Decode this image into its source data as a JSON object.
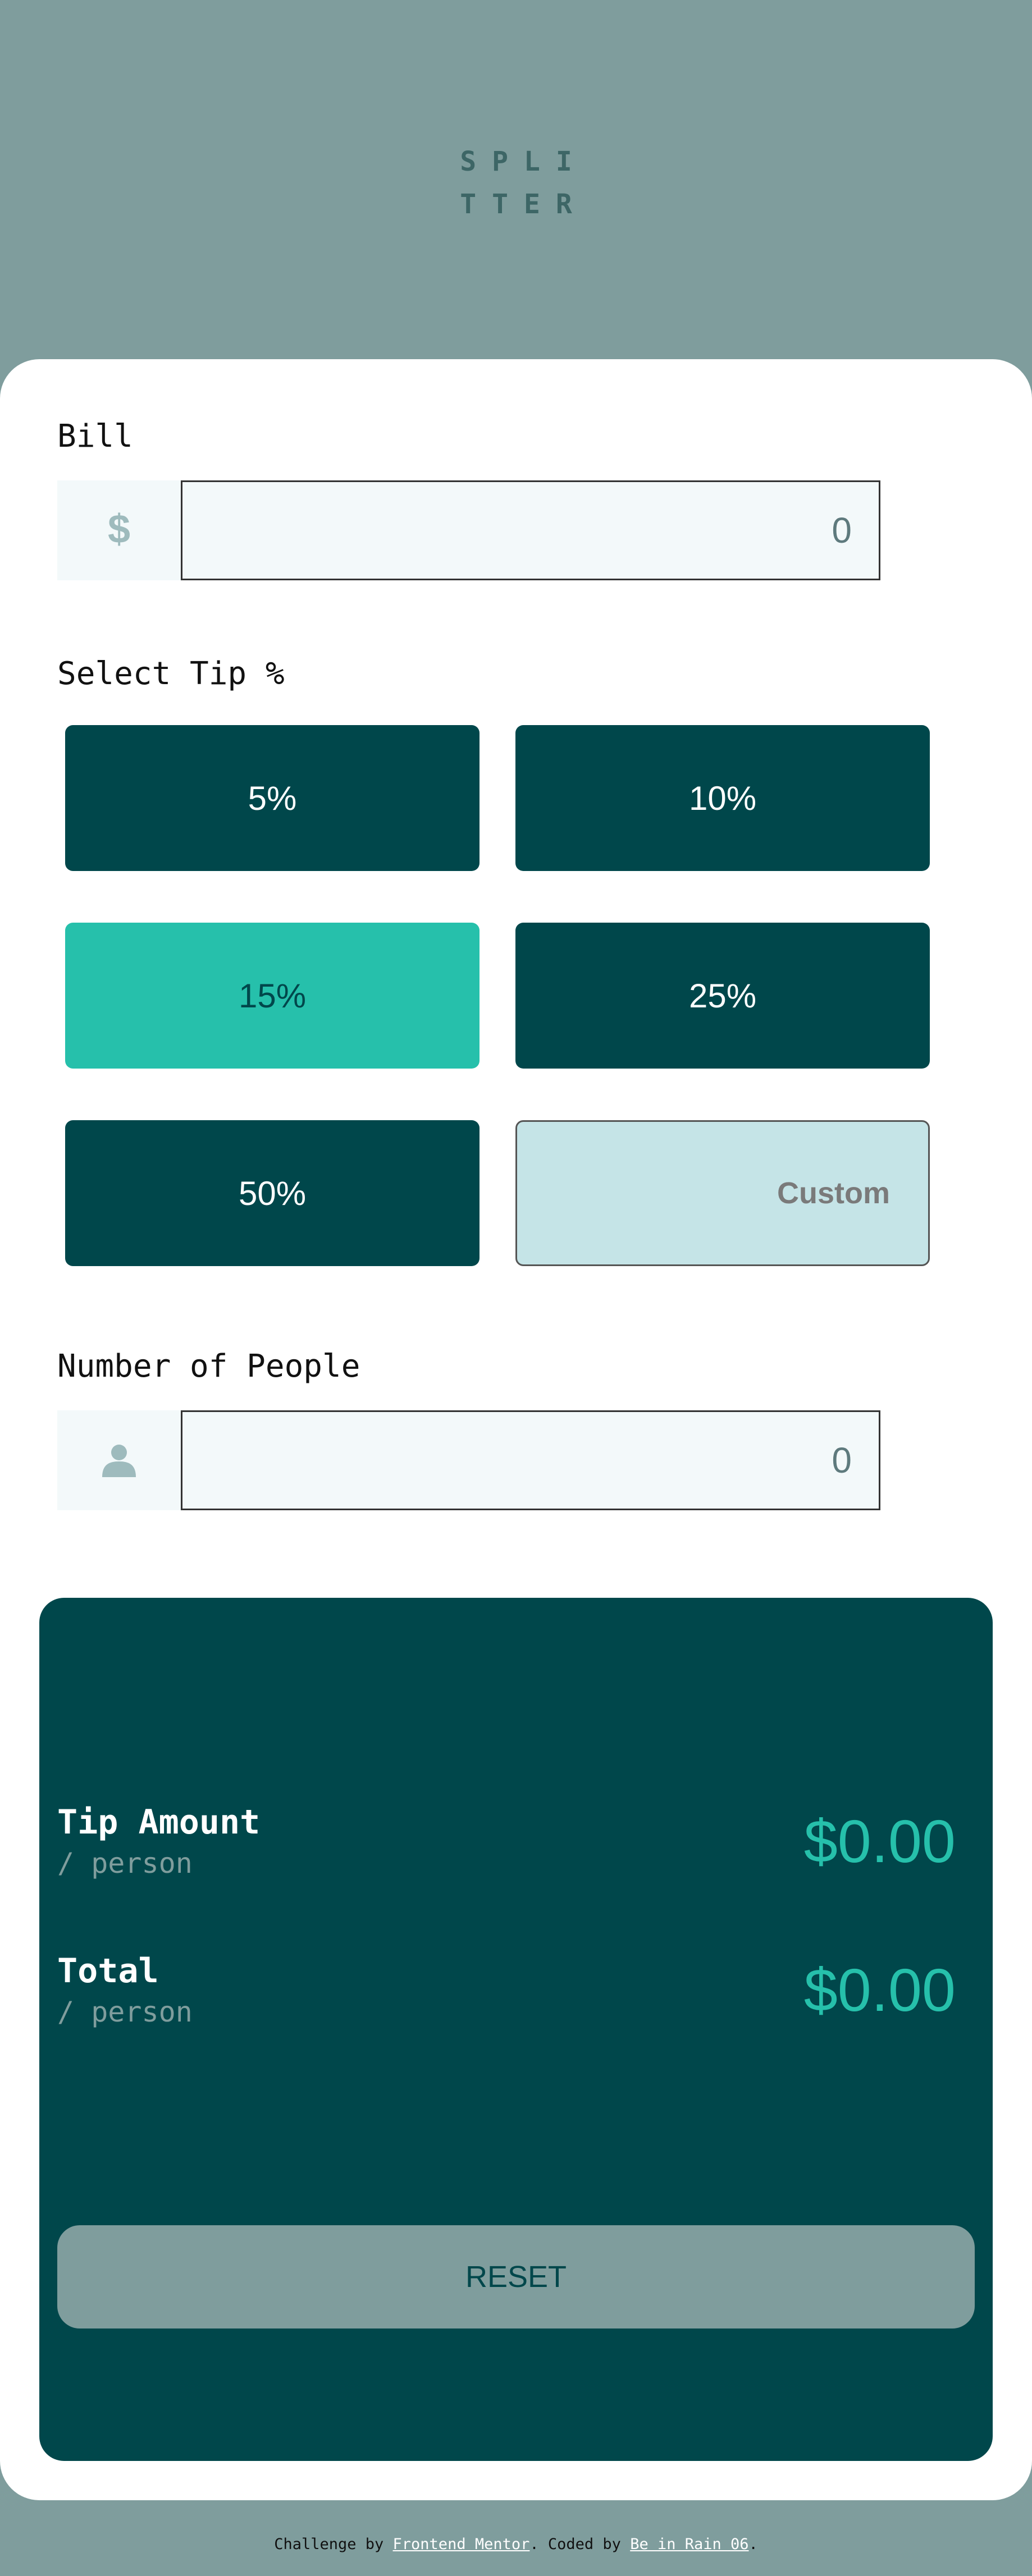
{
  "app": {
    "logo_line1": "SPLI",
    "logo_line2": "TTER"
  },
  "bill": {
    "label": "Bill",
    "icon": "dollar-icon",
    "value": "0"
  },
  "tip": {
    "label": "Select Tip %",
    "options": [
      "5%",
      "10%",
      "15%",
      "25%",
      "50%"
    ],
    "selected": "15%",
    "custom_placeholder": "Custom"
  },
  "people": {
    "label": "Number of People",
    "icon": "person-icon",
    "value": "0"
  },
  "results": {
    "tip_amount_label": "Tip Amount",
    "tip_amount_sub": "/ person",
    "tip_amount_value": "$0.00",
    "total_label": "Total",
    "total_sub": "/ person",
    "total_value": "$0.00",
    "reset_label": "RESET"
  },
  "footer": {
    "prefix": "Challenge by ",
    "link1": "Frontend Mentor",
    "middle": ". Coded by ",
    "link2": "Be in Rain 06",
    "suffix": "."
  },
  "colors": {
    "background": "#7f9d9d",
    "dark_cyan": "#00474b",
    "strong_cyan": "#26c0ab",
    "light_cyan": "#c5e4e7",
    "input_bg": "#f3f9fa"
  }
}
